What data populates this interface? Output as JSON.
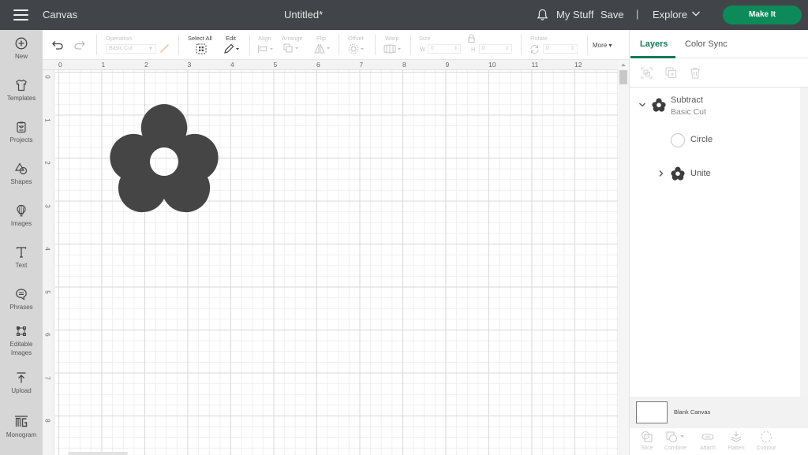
{
  "header": {
    "menu_icon": "hamburger-menu-icon",
    "app_title": "Canvas",
    "document_title": "Untitled*",
    "notifications_icon": "bell-icon",
    "my_stuff": "My Stuff",
    "save": "Save",
    "separator": "|",
    "explore": "Explore",
    "make_it": "Make It",
    "accent_color": "#0d8a5a"
  },
  "sidebar": {
    "items": [
      {
        "label": "New",
        "icon": "plus-circle-icon"
      },
      {
        "label": "Templates",
        "icon": "tshirt-icon"
      },
      {
        "label": "Projects",
        "icon": "projects-icon"
      },
      {
        "label": "Shapes",
        "icon": "shapes-icon"
      },
      {
        "label": "Images",
        "icon": "lightbulb-icon"
      },
      {
        "label": "Text",
        "icon": "text-icon"
      },
      {
        "label": "Phrases",
        "icon": "speech-bubble-icon"
      },
      {
        "label": "Editable Images",
        "icon": "editable-images-icon"
      },
      {
        "label": "Upload",
        "icon": "upload-icon"
      },
      {
        "label": "Monogram",
        "icon": "monogram-icon"
      }
    ]
  },
  "toolbar": {
    "operation_label": "Operation",
    "operation_value": "Basic Cut",
    "select_all": "Select All",
    "edit": "Edit",
    "align": "Align",
    "arrange": "Arrange",
    "flip": "Flip",
    "offset": "Offset",
    "warp": "Warp",
    "size": "Size",
    "width_label": "W",
    "width_value": "0",
    "height_label": "H",
    "height_value": "0",
    "rotate": "Rotate",
    "rotate_value": "0",
    "more": "More"
  },
  "rulers": {
    "top": [
      "0",
      "1",
      "2",
      "3",
      "4",
      "5",
      "6",
      "7",
      "8",
      "9",
      "10",
      "11",
      "12"
    ],
    "left": [
      "0",
      "1",
      "2",
      "3",
      "4",
      "5",
      "6",
      "7",
      "8"
    ]
  },
  "canvas": {
    "shape": "flower-with-hole",
    "shape_color": "#454545"
  },
  "panel": {
    "tabs": [
      {
        "label": "Layers",
        "active": true
      },
      {
        "label": "Color Sync",
        "active": false
      }
    ],
    "layers": [
      {
        "name": "Subtract",
        "sub": "Basic Cut",
        "expanded": true,
        "icon": "flower-icon"
      },
      {
        "name": "Circle",
        "icon": "circle-outline-icon"
      },
      {
        "name": "Unite",
        "expanded": false,
        "icon": "flower-icon"
      }
    ],
    "blank_canvas": "Blank Canvas",
    "bottom_actions": [
      "Slice",
      "Combine",
      "Attach",
      "Flatten",
      "Contour"
    ]
  }
}
